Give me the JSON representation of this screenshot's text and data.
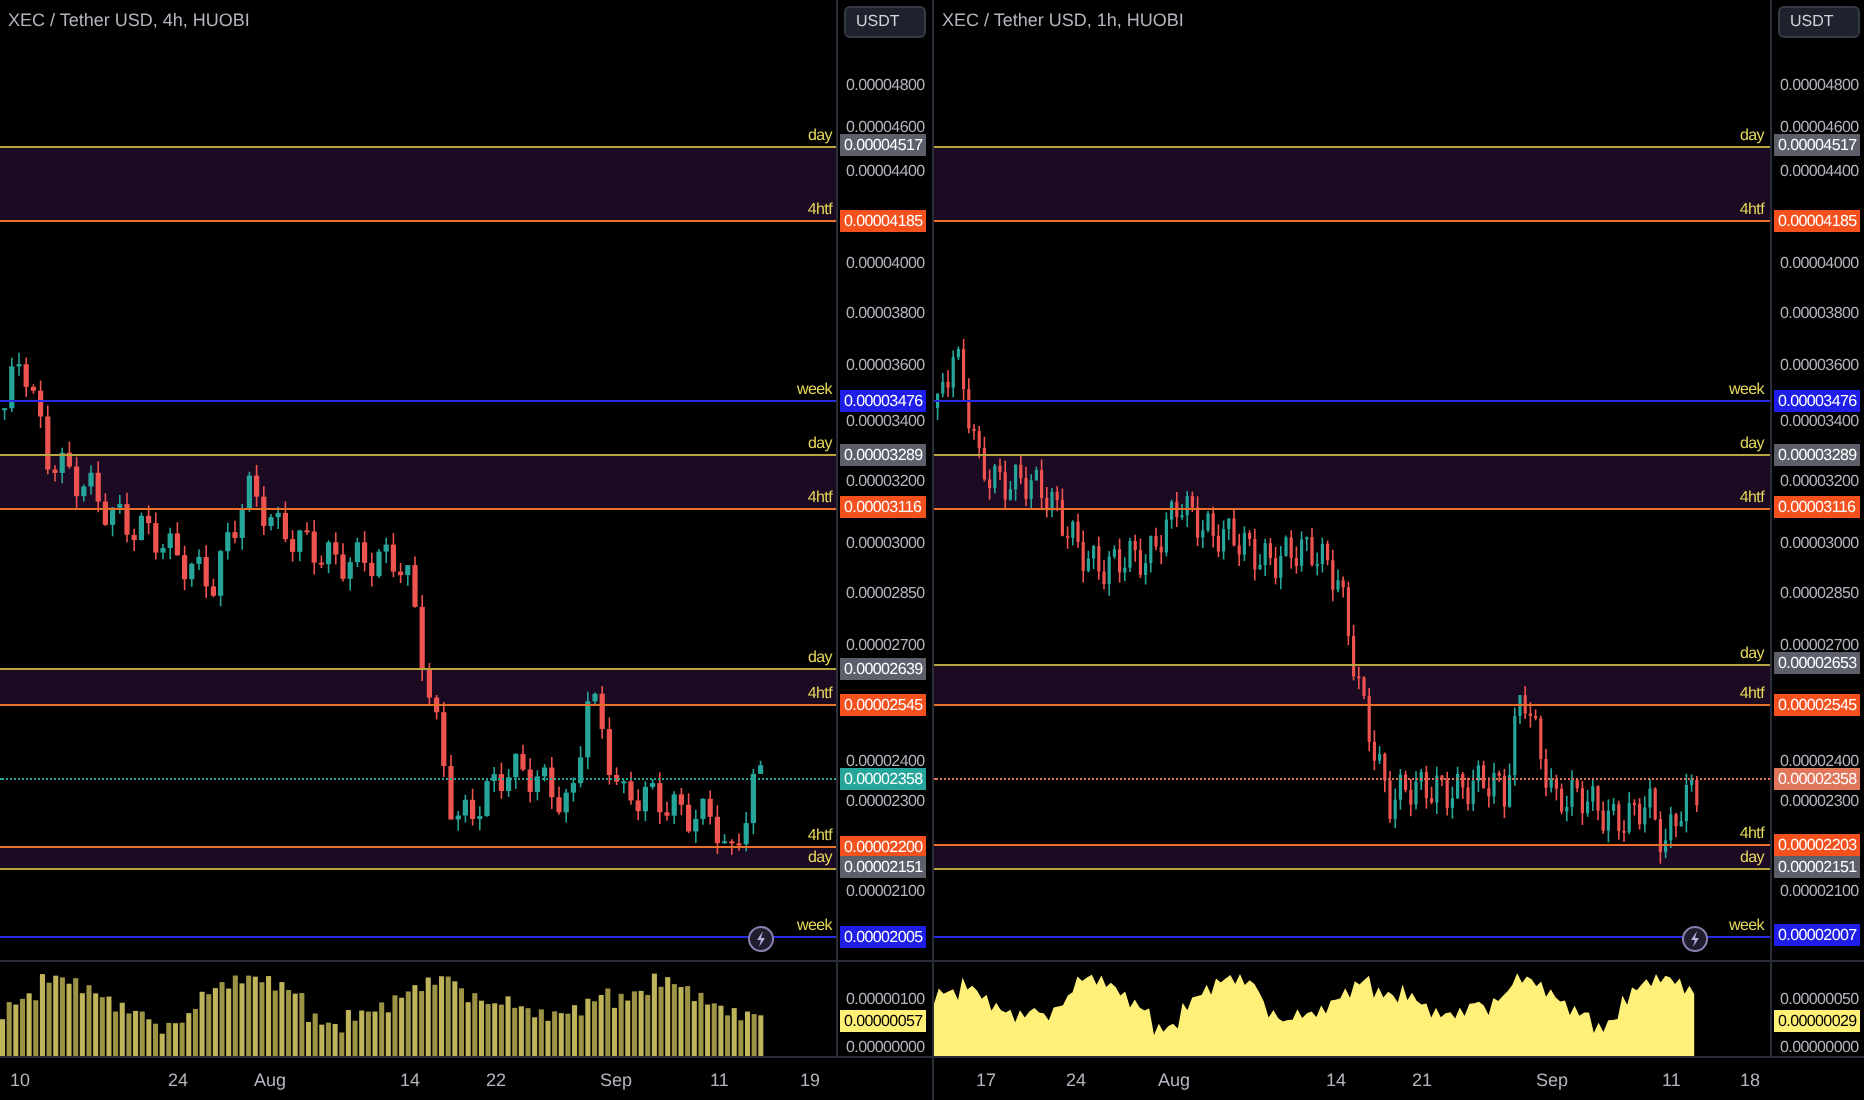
{
  "panels": [
    {
      "title": "XEC / Tether USD, 4h, HUOBI",
      "currency_button": "USDT",
      "price_ticks": [
        "0.00004800",
        "0.00004600",
        "0.00004400",
        "0.00004000",
        "0.00003800",
        "0.00003600",
        "0.00003400",
        "0.00003200",
        "0.00003000",
        "0.00002850",
        "0.00002700",
        "0.00002400",
        "0.00002300",
        "0.00002100"
      ],
      "levels": [
        {
          "tag": "day",
          "kind": "day",
          "value": "0.00004517",
          "color": "#5d606b",
          "zone_to_next": true
        },
        {
          "tag": "4htf",
          "kind": "htf",
          "value": "0.00004185",
          "color": "#f4511e",
          "zone_to_next": false
        },
        {
          "tag": "week",
          "kind": "week",
          "value": "0.00003476",
          "color": "#1e1ee8",
          "zone_to_next": false
        },
        {
          "tag": "day",
          "kind": "day",
          "value": "0.00003289",
          "color": "#5d606b",
          "zone_to_next": true
        },
        {
          "tag": "4htf",
          "kind": "htf",
          "value": "0.00003116",
          "color": "#f4511e",
          "zone_to_next": false
        },
        {
          "tag": "day",
          "kind": "day",
          "value": "0.00002639",
          "color": "#5d606b",
          "zone_to_next": true
        },
        {
          "tag": "4htf",
          "kind": "htf",
          "value": "0.00002545",
          "color": "#f4511e",
          "zone_to_next": false
        },
        {
          "tag": "4htf",
          "kind": "htf",
          "value": "0.00002200",
          "color": "#f4511e",
          "zone_to_next": true
        },
        {
          "tag": "day",
          "kind": "day",
          "value": "0.00002151",
          "color": "#5d606b",
          "zone_to_next": false
        },
        {
          "tag": "week",
          "kind": "week",
          "value": "0.00002005",
          "color": "#1e1ee8",
          "zone_to_next": false
        }
      ],
      "last_price": {
        "value": "0.00002358",
        "color": "#26a69a"
      },
      "volume": {
        "kind": "bars",
        "ticks": [
          "0.00000100",
          "0.00000000"
        ],
        "last": "0.00000057"
      },
      "time_labels": [
        "10",
        "24",
        "Aug",
        "14",
        "22",
        "Sep",
        "11",
        "19"
      ]
    },
    {
      "title": "XEC / Tether USD, 1h, HUOBI",
      "currency_button": "USDT",
      "price_ticks": [
        "0.00004800",
        "0.00004600",
        "0.00004400",
        "0.00004000",
        "0.00003800",
        "0.00003600",
        "0.00003400",
        "0.00003200",
        "0.00003000",
        "0.00002850",
        "0.00002700",
        "0.00002400",
        "0.00002300",
        "0.00002100"
      ],
      "levels": [
        {
          "tag": "day",
          "kind": "day",
          "value": "0.00004517",
          "color": "#5d606b",
          "zone_to_next": true
        },
        {
          "tag": "4htf",
          "kind": "htf",
          "value": "0.00004185",
          "color": "#f4511e",
          "zone_to_next": false
        },
        {
          "tag": "week",
          "kind": "week",
          "value": "0.00003476",
          "color": "#1e1ee8",
          "zone_to_next": false
        },
        {
          "tag": "day",
          "kind": "day",
          "value": "0.00003289",
          "color": "#5d606b",
          "zone_to_next": true
        },
        {
          "tag": "4htf",
          "kind": "htf",
          "value": "0.00003116",
          "color": "#f4511e",
          "zone_to_next": false
        },
        {
          "tag": "day",
          "kind": "day",
          "value": "0.00002653",
          "color": "#5d606b",
          "zone_to_next": true
        },
        {
          "tag": "4htf",
          "kind": "htf",
          "value": "0.00002545",
          "color": "#f4511e",
          "zone_to_next": false
        },
        {
          "tag": "4htf",
          "kind": "htf",
          "value": "0.00002203",
          "color": "#f4511e",
          "zone_to_next": true
        },
        {
          "tag": "day",
          "kind": "day",
          "value": "0.00002151",
          "color": "#5d606b",
          "zone_to_next": false
        },
        {
          "tag": "week",
          "kind": "week",
          "value": "0.00002007",
          "color": "#1e1ee8",
          "zone_to_next": false
        }
      ],
      "last_price": {
        "value": "0.00002358",
        "color": "#e0765a"
      },
      "volume": {
        "kind": "area",
        "ticks": [
          "0.00000050",
          "0.00000000"
        ],
        "last": "0.00000029"
      },
      "time_labels": [
        "17",
        "24",
        "Aug",
        "14",
        "21",
        "Sep",
        "11",
        "18"
      ]
    }
  ]
}
